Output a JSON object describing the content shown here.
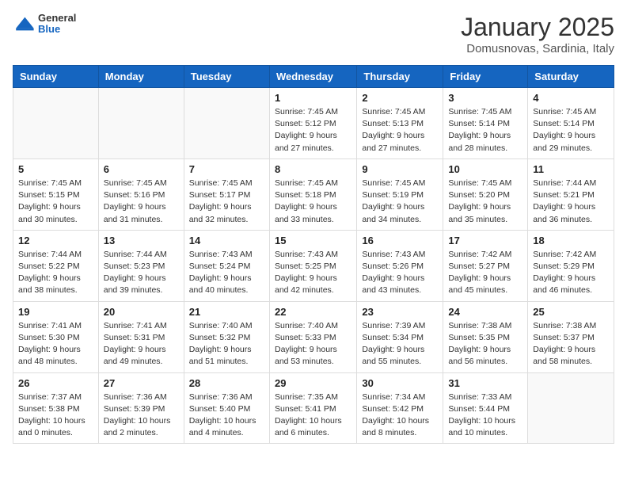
{
  "header": {
    "logo_general": "General",
    "logo_blue": "Blue",
    "month_title": "January 2025",
    "location": "Domusnovas, Sardinia, Italy"
  },
  "days_of_week": [
    "Sunday",
    "Monday",
    "Tuesday",
    "Wednesday",
    "Thursday",
    "Friday",
    "Saturday"
  ],
  "weeks": [
    [
      {
        "day": "",
        "info": ""
      },
      {
        "day": "",
        "info": ""
      },
      {
        "day": "",
        "info": ""
      },
      {
        "day": "1",
        "info": "Sunrise: 7:45 AM\nSunset: 5:12 PM\nDaylight: 9 hours and 27 minutes."
      },
      {
        "day": "2",
        "info": "Sunrise: 7:45 AM\nSunset: 5:13 PM\nDaylight: 9 hours and 27 minutes."
      },
      {
        "day": "3",
        "info": "Sunrise: 7:45 AM\nSunset: 5:14 PM\nDaylight: 9 hours and 28 minutes."
      },
      {
        "day": "4",
        "info": "Sunrise: 7:45 AM\nSunset: 5:14 PM\nDaylight: 9 hours and 29 minutes."
      }
    ],
    [
      {
        "day": "5",
        "info": "Sunrise: 7:45 AM\nSunset: 5:15 PM\nDaylight: 9 hours and 30 minutes."
      },
      {
        "day": "6",
        "info": "Sunrise: 7:45 AM\nSunset: 5:16 PM\nDaylight: 9 hours and 31 minutes."
      },
      {
        "day": "7",
        "info": "Sunrise: 7:45 AM\nSunset: 5:17 PM\nDaylight: 9 hours and 32 minutes."
      },
      {
        "day": "8",
        "info": "Sunrise: 7:45 AM\nSunset: 5:18 PM\nDaylight: 9 hours and 33 minutes."
      },
      {
        "day": "9",
        "info": "Sunrise: 7:45 AM\nSunset: 5:19 PM\nDaylight: 9 hours and 34 minutes."
      },
      {
        "day": "10",
        "info": "Sunrise: 7:45 AM\nSunset: 5:20 PM\nDaylight: 9 hours and 35 minutes."
      },
      {
        "day": "11",
        "info": "Sunrise: 7:44 AM\nSunset: 5:21 PM\nDaylight: 9 hours and 36 minutes."
      }
    ],
    [
      {
        "day": "12",
        "info": "Sunrise: 7:44 AM\nSunset: 5:22 PM\nDaylight: 9 hours and 38 minutes."
      },
      {
        "day": "13",
        "info": "Sunrise: 7:44 AM\nSunset: 5:23 PM\nDaylight: 9 hours and 39 minutes."
      },
      {
        "day": "14",
        "info": "Sunrise: 7:43 AM\nSunset: 5:24 PM\nDaylight: 9 hours and 40 minutes."
      },
      {
        "day": "15",
        "info": "Sunrise: 7:43 AM\nSunset: 5:25 PM\nDaylight: 9 hours and 42 minutes."
      },
      {
        "day": "16",
        "info": "Sunrise: 7:43 AM\nSunset: 5:26 PM\nDaylight: 9 hours and 43 minutes."
      },
      {
        "day": "17",
        "info": "Sunrise: 7:42 AM\nSunset: 5:27 PM\nDaylight: 9 hours and 45 minutes."
      },
      {
        "day": "18",
        "info": "Sunrise: 7:42 AM\nSunset: 5:29 PM\nDaylight: 9 hours and 46 minutes."
      }
    ],
    [
      {
        "day": "19",
        "info": "Sunrise: 7:41 AM\nSunset: 5:30 PM\nDaylight: 9 hours and 48 minutes."
      },
      {
        "day": "20",
        "info": "Sunrise: 7:41 AM\nSunset: 5:31 PM\nDaylight: 9 hours and 49 minutes."
      },
      {
        "day": "21",
        "info": "Sunrise: 7:40 AM\nSunset: 5:32 PM\nDaylight: 9 hours and 51 minutes."
      },
      {
        "day": "22",
        "info": "Sunrise: 7:40 AM\nSunset: 5:33 PM\nDaylight: 9 hours and 53 minutes."
      },
      {
        "day": "23",
        "info": "Sunrise: 7:39 AM\nSunset: 5:34 PM\nDaylight: 9 hours and 55 minutes."
      },
      {
        "day": "24",
        "info": "Sunrise: 7:38 AM\nSunset: 5:35 PM\nDaylight: 9 hours and 56 minutes."
      },
      {
        "day": "25",
        "info": "Sunrise: 7:38 AM\nSunset: 5:37 PM\nDaylight: 9 hours and 58 minutes."
      }
    ],
    [
      {
        "day": "26",
        "info": "Sunrise: 7:37 AM\nSunset: 5:38 PM\nDaylight: 10 hours and 0 minutes."
      },
      {
        "day": "27",
        "info": "Sunrise: 7:36 AM\nSunset: 5:39 PM\nDaylight: 10 hours and 2 minutes."
      },
      {
        "day": "28",
        "info": "Sunrise: 7:36 AM\nSunset: 5:40 PM\nDaylight: 10 hours and 4 minutes."
      },
      {
        "day": "29",
        "info": "Sunrise: 7:35 AM\nSunset: 5:41 PM\nDaylight: 10 hours and 6 minutes."
      },
      {
        "day": "30",
        "info": "Sunrise: 7:34 AM\nSunset: 5:42 PM\nDaylight: 10 hours and 8 minutes."
      },
      {
        "day": "31",
        "info": "Sunrise: 7:33 AM\nSunset: 5:44 PM\nDaylight: 10 hours and 10 minutes."
      },
      {
        "day": "",
        "info": ""
      }
    ]
  ]
}
